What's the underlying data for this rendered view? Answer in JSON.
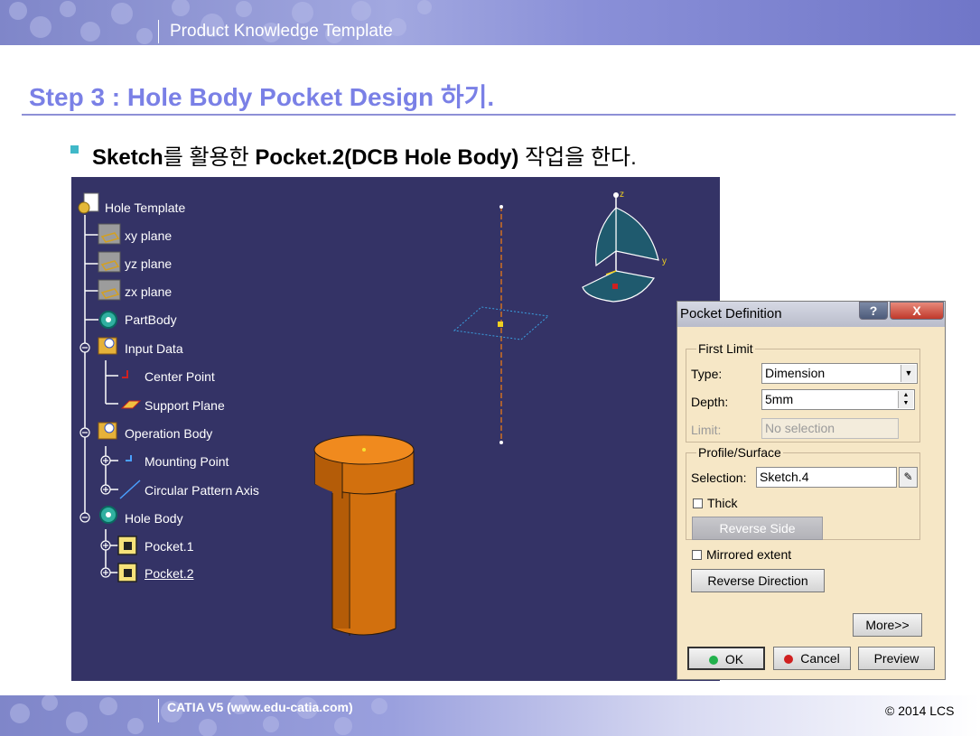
{
  "header": {
    "title": "Product Knowledge Template"
  },
  "slide": {
    "step_title": "Step 3 : Hole Body Pocket Design 하기.",
    "subtitle_parts": [
      "Sketch",
      "를 활용한 ",
      "Pocket.2(DCB Hole Body)",
      " 작업을 한다."
    ]
  },
  "tree": {
    "root": "Hole Template",
    "xy_plane": "xy plane",
    "yz_plane": "yz plane",
    "zx_plane": "zx plane",
    "part_body": "PartBody",
    "input_data": "Input Data",
    "center_point": "Center Point",
    "support_plane": "Support Plane",
    "operation_body": "Operation Body",
    "mounting_point": "Mounting Point",
    "circular_pattern_axis": "Circular Pattern Axis",
    "hole_body": "Hole Body",
    "pocket1": "Pocket.1",
    "pocket2": "Pocket.2"
  },
  "compass": {
    "z": "z",
    "y": "y"
  },
  "dialog": {
    "title": "Pocket Definition",
    "help_label": "?",
    "close_label": "X",
    "first_limit": {
      "group_label": "First Limit",
      "type_label": "Type:",
      "type_value": "Dimension",
      "depth_label": "Depth:",
      "depth_value": "5mm",
      "limit_label": "Limit:",
      "limit_value": "No selection"
    },
    "profile": {
      "group_label": "Profile/Surface",
      "selection_label": "Selection:",
      "selection_value": "Sketch.4",
      "thick_label": "Thick",
      "reverse_side_label": "Reverse Side"
    },
    "mirrored_label": "Mirrored extent",
    "reverse_direction_label": "Reverse Direction",
    "more_label": "More>>",
    "ok_label": "OK",
    "cancel_label": "Cancel",
    "preview_label": "Preview"
  },
  "footer": {
    "left_text": "CATIA V5 (www.edu-catia.com)",
    "copyright": "© 2014 LCS"
  },
  "colors": {
    "banner": "#8a90d8",
    "step_title": "#7a80e6",
    "viewport_bg": "#343366",
    "dialog_bg": "#f6e7c6",
    "part_orange": "#e07b1a"
  }
}
